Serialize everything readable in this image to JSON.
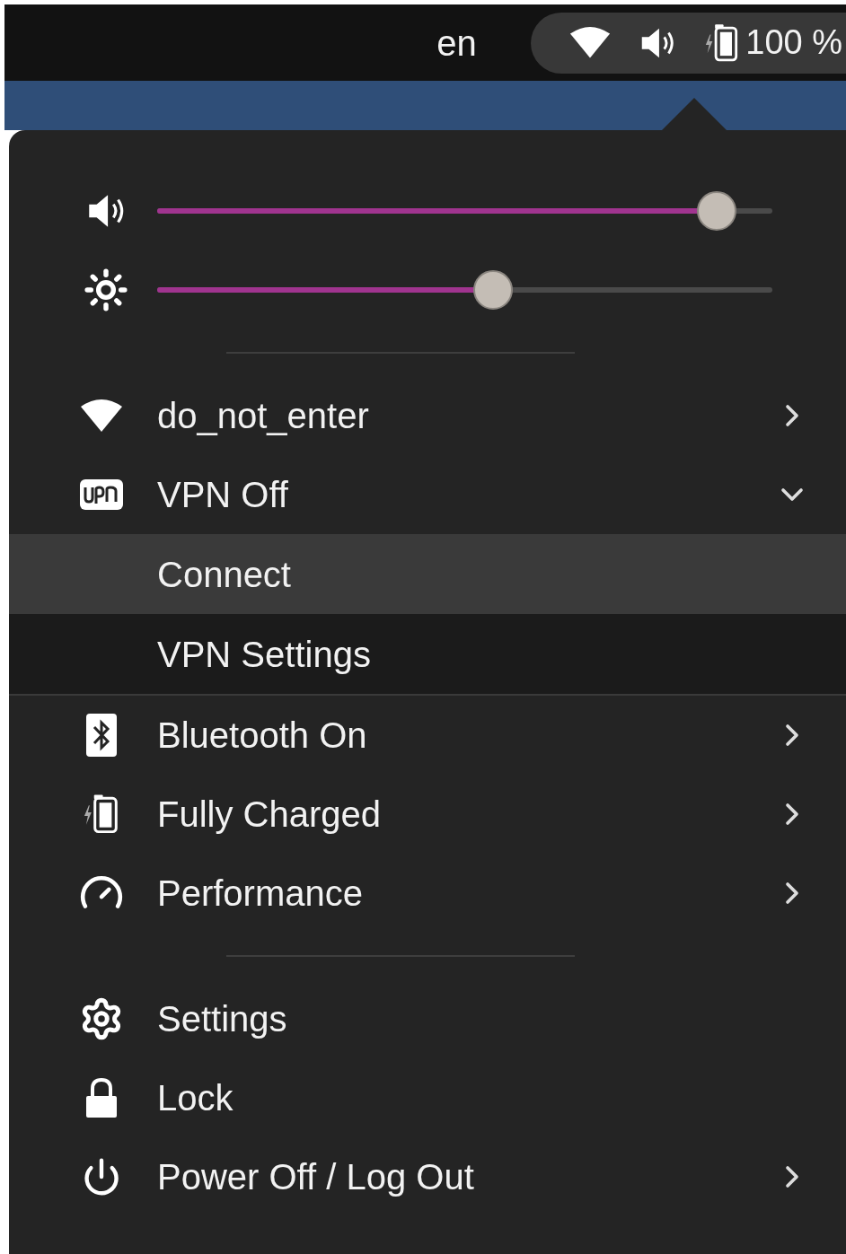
{
  "top_bar": {
    "language": "en",
    "battery_percent": "100 %"
  },
  "sliders": [
    {
      "kind": "volume",
      "level": 0.91
    },
    {
      "kind": "brightness",
      "level": 0.546
    }
  ],
  "menu_items": [
    {
      "kind": "wifi",
      "label": "do_not_enter",
      "submenu": true,
      "expanded": false
    },
    {
      "kind": "vpn",
      "label": "VPN Off",
      "submenu": true,
      "expanded": true,
      "children": [
        {
          "label": "Connect",
          "selected": true
        },
        {
          "label": "VPN Settings",
          "selected": false
        }
      ]
    },
    {
      "kind": "bluetooth",
      "label": "Bluetooth On",
      "submenu": true,
      "expanded": false
    },
    {
      "kind": "battery",
      "label": "Fully Charged",
      "submenu": true,
      "expanded": false
    },
    {
      "kind": "performance",
      "label": "Performance",
      "submenu": true,
      "expanded": false
    },
    {
      "kind": "settings",
      "label": "Settings",
      "submenu": false,
      "expanded": false
    },
    {
      "kind": "lock",
      "label": "Lock",
      "submenu": false,
      "expanded": false
    },
    {
      "kind": "power",
      "label": "Power Off / Log Out",
      "submenu": true,
      "expanded": false
    }
  ]
}
